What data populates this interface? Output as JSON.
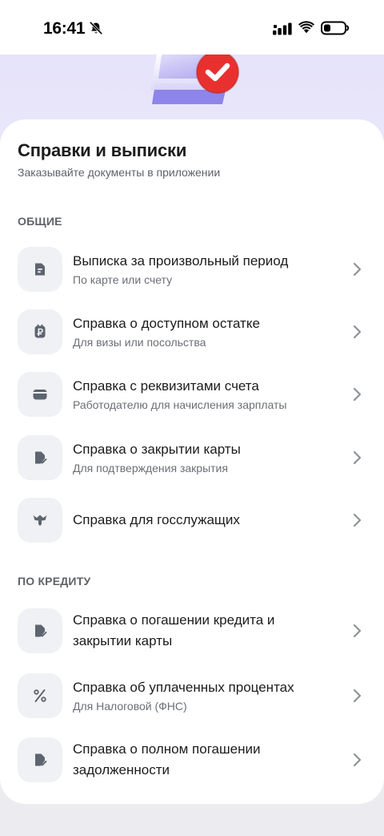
{
  "status_bar": {
    "time": "16:41",
    "icons": [
      "bell-slash-icon",
      "cellular-signal-icon",
      "wifi-icon",
      "battery-icon"
    ]
  },
  "hero": {
    "illustration": "document-checkmark-icon",
    "accent_color": "#ea2b2b",
    "background_color": "#e6e3fa"
  },
  "header": {
    "title": "Справки и выписки",
    "subtitle": "Заказывайте документы в приложении"
  },
  "sections": [
    {
      "title": "ОБЩИЕ",
      "items": [
        {
          "icon": "document-icon",
          "title": "Выписка за произвольный период",
          "subtitle": "По карте или счету"
        },
        {
          "icon": "ruble-document-icon",
          "title": "Справка о доступном остатке",
          "subtitle": "Для визы или посольства"
        },
        {
          "icon": "wallet-icon",
          "title": "Справка с реквизитами счета",
          "subtitle": "Работодателю для начисления зарплаты"
        },
        {
          "icon": "document-check-icon",
          "title": "Справка о закрытии карты",
          "subtitle": "Для подтверждения закрытия"
        },
        {
          "icon": "coat-of-arms-icon",
          "title": "Справка для госслужащих",
          "subtitle": ""
        }
      ]
    },
    {
      "title": "ПО КРЕДИТУ",
      "items": [
        {
          "icon": "document-check-icon",
          "title": "Справка о погашении кредита и закрытии карты",
          "subtitle": ""
        },
        {
          "icon": "percent-icon",
          "title": "Справка об уплаченных процентах",
          "subtitle": "Для Налоговой (ФНС)"
        },
        {
          "icon": "document-check-icon",
          "title": "Справка о полном погашении задолженности",
          "subtitle": ""
        }
      ]
    }
  ],
  "colors": {
    "text_primary": "#1c1c1e",
    "text_secondary": "#6b6f75",
    "icon_bg": "#f0f1f4",
    "icon_fg": "#5e6470",
    "chevron": "#8e9299"
  }
}
